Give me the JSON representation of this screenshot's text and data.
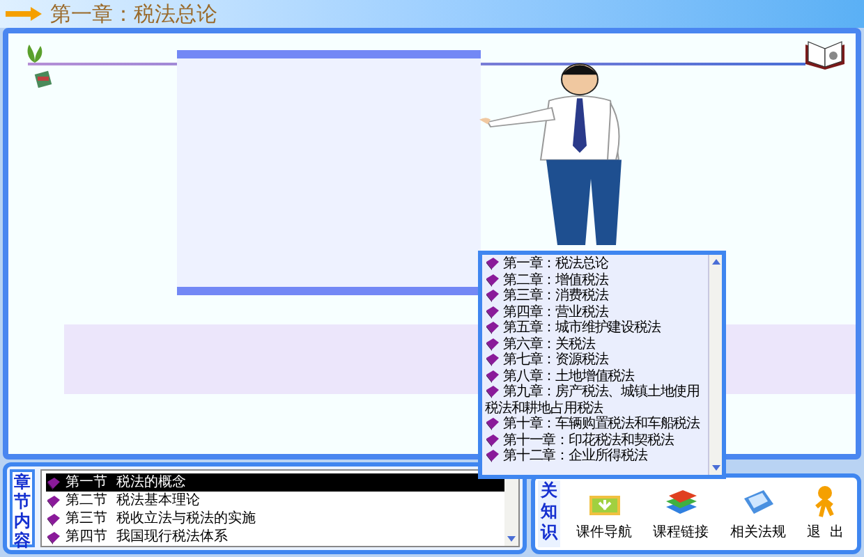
{
  "title": "第一章：税法总论",
  "chapters": [
    {
      "label": "第一章：税法总论"
    },
    {
      "label": "第二章：增值税法"
    },
    {
      "label": "第三章：消费税法"
    },
    {
      "label": "第四章：营业税法"
    },
    {
      "label": "第五章：城市维护建设税法"
    },
    {
      "label": "第六章：关税法"
    },
    {
      "label": "第七章：资源税法"
    },
    {
      "label": "第八章：土地增值税法"
    },
    {
      "label": "第九章：房产税法、城镇土地使用税法和耕地占用税法"
    },
    {
      "label": "第十章：车辆购置税法和车船税法"
    },
    {
      "label": "第十一章：印花税法和契税法"
    },
    {
      "label": "第十二章：企业所得税法"
    }
  ],
  "sections_label": "章节内容",
  "sections": [
    {
      "label": "第一节  税法的概念",
      "selected": true
    },
    {
      "label": "第二节  税法基本理论",
      "selected": false
    },
    {
      "label": "第三节  税收立法与税法的实施",
      "selected": false
    },
    {
      "label": "第四节  我国现行税法体系",
      "selected": false
    }
  ],
  "knowledge_label": "关知识",
  "tools": [
    {
      "kind": "nav",
      "label": "课件导航"
    },
    {
      "kind": "links",
      "label": "课程链接"
    },
    {
      "kind": "laws",
      "label": "相关法规"
    },
    {
      "kind": "exit",
      "label": "退  出"
    }
  ]
}
